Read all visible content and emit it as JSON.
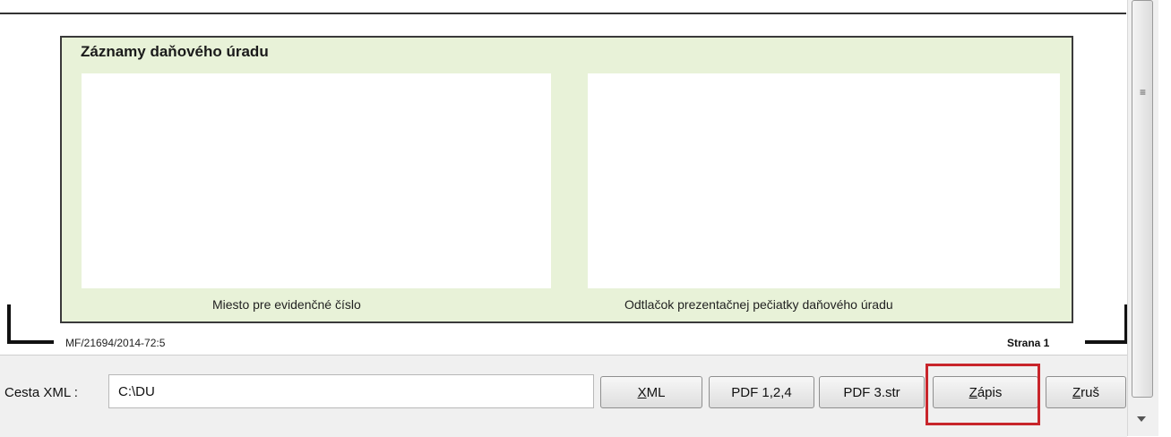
{
  "document": {
    "section_title": "Záznamy daňového úradu",
    "caption_left": "Miesto pre evidenčné číslo",
    "caption_right": "Odtlačok prezentačnej pečiatky daňového úradu",
    "form_id": "MF/21694/2014-72:5",
    "page_label": "Strana 1"
  },
  "toolbar": {
    "path_label": "Cesta XML :",
    "path_value": "C:\\DU",
    "buttons": [
      {
        "mnemonic": "X",
        "rest": "ML"
      },
      {
        "label": "PDF 1,2,4"
      },
      {
        "label": "PDF 3.str"
      },
      {
        "mnemonic": "Z",
        "rest": "ápis"
      },
      {
        "mnemonic": "Z",
        "rest": "ruš"
      }
    ]
  },
  "scrollbar": {
    "grip_icon": "≡"
  },
  "colors": {
    "box_fill": "#e8f2d8",
    "highlight": "#c8252b"
  }
}
